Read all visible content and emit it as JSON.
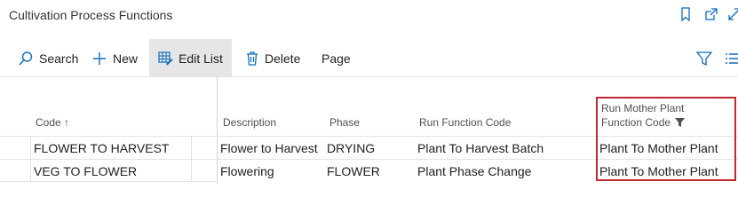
{
  "page": {
    "title": "Cultivation Process Functions"
  },
  "window_icons": [
    "bookmark-icon",
    "open-new-window-icon",
    "collapse-icon"
  ],
  "toolbar": {
    "search_label": "Search",
    "new_label": "New",
    "edit_list_label": "Edit List",
    "delete_label": "Delete",
    "page_label": "Page",
    "right_icons": [
      "filter-icon",
      "list-view-icon"
    ]
  },
  "table": {
    "columns": {
      "code": "Code ↑",
      "description": "Description",
      "phase": "Phase",
      "run_function_code": "Run Function Code",
      "mother_line1": "Run Mother Plant",
      "mother_line2": "Function Code"
    },
    "rows": [
      {
        "code": "FLOWER TO HARVEST",
        "description": "Flower to Harvest",
        "phase": "DRYING",
        "run_function_code": "Plant To Harvest Batch",
        "mother_function_code": "Plant To Mother Plant"
      },
      {
        "code": "VEG TO FLOWER",
        "description": "Flowering",
        "phase": "FLOWER",
        "run_function_code": "Plant Phase Change",
        "mother_function_code": "Plant To Mother Plant"
      }
    ]
  },
  "colors": {
    "highlight": "#c0282d",
    "accent": "#0f6cbd"
  }
}
